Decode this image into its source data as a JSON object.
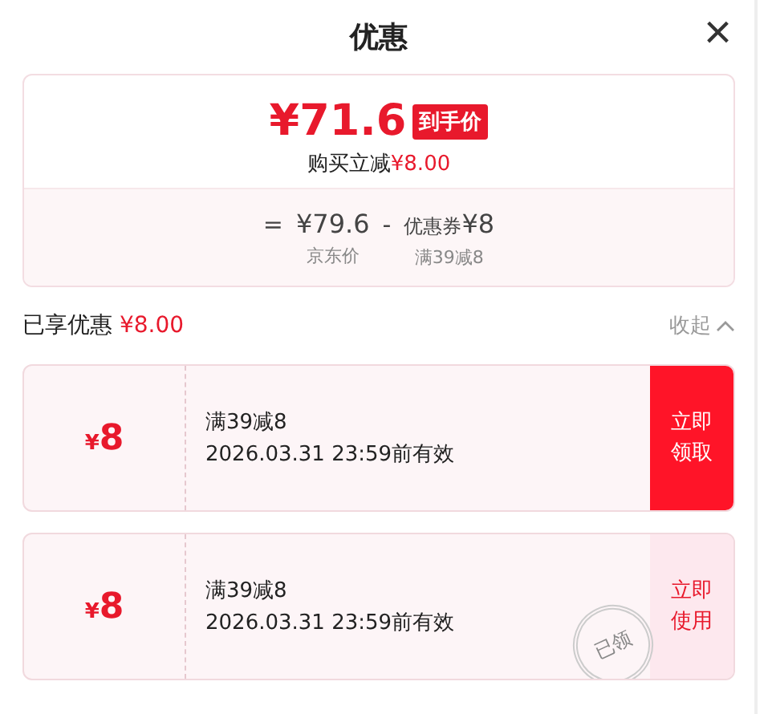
{
  "title": "优惠",
  "close": "×",
  "summary": {
    "price": "¥71.6",
    "price_badge": "到手价",
    "saving_label": "购买立减",
    "saving": "¥8.00",
    "formula": [
      {
        "kind": "sign",
        "text": "="
      },
      {
        "kind": "amount",
        "text": "¥79.6",
        "caption": "京东价"
      },
      {
        "kind": "sign",
        "text": "-"
      },
      {
        "kind": "coupon",
        "prefix": "优惠券",
        "text": "¥8",
        "caption": "满39减8"
      }
    ]
  },
  "enjoyed": {
    "label": "已享优惠",
    "amount": "¥8.00",
    "toggle": "收起",
    "expanded": true
  },
  "coupons": [
    {
      "currency": "¥",
      "amount": "8",
      "condition": "满39减8",
      "validity": "2026.03.31 23:59前有效",
      "action": "立即领取",
      "claimed": false
    },
    {
      "currency": "¥",
      "amount": "8",
      "condition": "满39减8",
      "validity": "2026.03.31 23:59前有效",
      "action": "立即使用",
      "claimed": true,
      "stamp": "已领"
    }
  ]
}
